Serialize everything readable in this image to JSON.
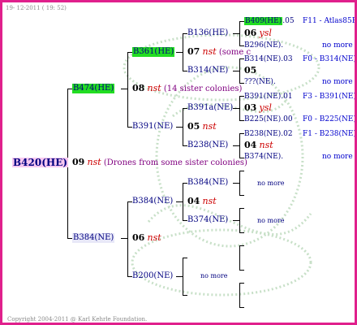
{
  "header": {
    "date": "19- 12-2011 ( 19: 52)"
  },
  "footer": {
    "copyright": "Copyright 2004-2011 @ Karl Kehrle Foundation."
  },
  "root": {
    "name": "B420(HE)"
  },
  "gen1": {
    "gen09": "09",
    "nst": "nst",
    "note": "(Drones from some sister colonies)",
    "top": "B474(HE)",
    "bottom": "B384(NE)"
  },
  "gen2": {
    "a": {
      "name": "B361(HE)",
      "gen": "07",
      "nst": "nst",
      "note": "(some c"
    },
    "gen08": "08",
    "nst08": "nst",
    "note08": "(14 sister colonies)",
    "b": {
      "name": "B391(NE)"
    },
    "c": {
      "name": "B384(NE)"
    },
    "gen06": "06",
    "nst06": "nst",
    "d": {
      "name": "B200(NE)"
    },
    "d_more": "no more"
  },
  "gen3": {
    "b136": "B136(HE)",
    "b314": "B314(NE)",
    "b391a": "B391a(NE)",
    "gen05": "05",
    "nst05": "nst",
    "b238": "B238(NE)",
    "b384": "B384(NE)",
    "gen04": "04",
    "nst04": "nst",
    "b374": "B374(NE)"
  },
  "gen4": {
    "r1": {
      "name": "B409(HE)",
      "code": ".05",
      "id": "F11 - Atlas85R"
    },
    "r1_gen": "06",
    "r1_nst": "ysl",
    "r2": {
      "name": "B296(NE)",
      "code": ".",
      "id": "no more"
    },
    "r3": {
      "name": "B314(NE)",
      "code": ".03",
      "id": "F0 - B314(NE)"
    },
    "r3_gen": "05",
    "r4": {
      "name": "???(NE)",
      "code": ".",
      "id": "no more"
    },
    "r5": {
      "name": "B391(NE)",
      "code": ".01",
      "id": "F3 - B391(NE)"
    },
    "r5_gen": "03",
    "r5_nst": "ysl",
    "r6": {
      "name": "B225(NE)",
      "code": ".00",
      "id": "F0 - B225(NE)"
    },
    "r7": {
      "name": "B238(NE)",
      "code": ".02",
      "id": "F1 - B238(NE)"
    },
    "r7_gen": "04",
    "r7_nst": "nst",
    "r8": {
      "name": "B374(NE)",
      "code": ".",
      "id": "no more"
    },
    "b384_more": "no more",
    "b374_more": "no more"
  }
}
